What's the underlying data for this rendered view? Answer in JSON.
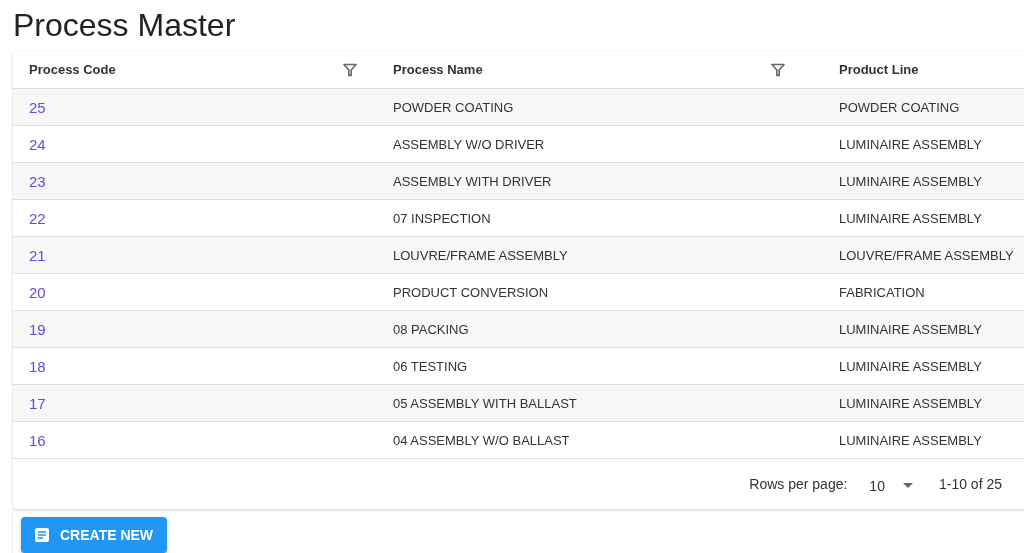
{
  "page_title": "Process Master",
  "table": {
    "columns": [
      {
        "label": "Process Code",
        "filter": true
      },
      {
        "label": "Process Name",
        "filter": true
      },
      {
        "label": "Product Line",
        "filter": false
      }
    ],
    "rows": [
      {
        "code": "25",
        "name": "POWDER COATING",
        "product_line": "POWDER COATING"
      },
      {
        "code": "24",
        "name": "ASSEMBLY W/O DRIVER",
        "product_line": "LUMINAIRE ASSEMBLY"
      },
      {
        "code": "23",
        "name": "ASSEMBLY WITH DRIVER",
        "product_line": "LUMINAIRE ASSEMBLY"
      },
      {
        "code": "22",
        "name": "07 INSPECTION",
        "product_line": "LUMINAIRE ASSEMBLY"
      },
      {
        "code": "21",
        "name": "LOUVRE/FRAME ASSEMBLY",
        "product_line": "LOUVRE/FRAME ASSEMBLY"
      },
      {
        "code": "20",
        "name": "PRODUCT CONVERSION",
        "product_line": "FABRICATION"
      },
      {
        "code": "19",
        "name": "08 PACKING",
        "product_line": "LUMINAIRE ASSEMBLY"
      },
      {
        "code": "18",
        "name": "06 TESTING",
        "product_line": "LUMINAIRE ASSEMBLY"
      },
      {
        "code": "17",
        "name": "05 ASSEMBLY WITH BALLAST",
        "product_line": "LUMINAIRE ASSEMBLY"
      },
      {
        "code": "16",
        "name": "04 ASSEMBLY W/O BALLAST",
        "product_line": "LUMINAIRE ASSEMBLY"
      }
    ]
  },
  "pagination": {
    "rows_per_page_label": "Rows per page:",
    "rows_per_page": "10",
    "range": "1-10 of 25"
  },
  "create_button": "CREATE NEW"
}
